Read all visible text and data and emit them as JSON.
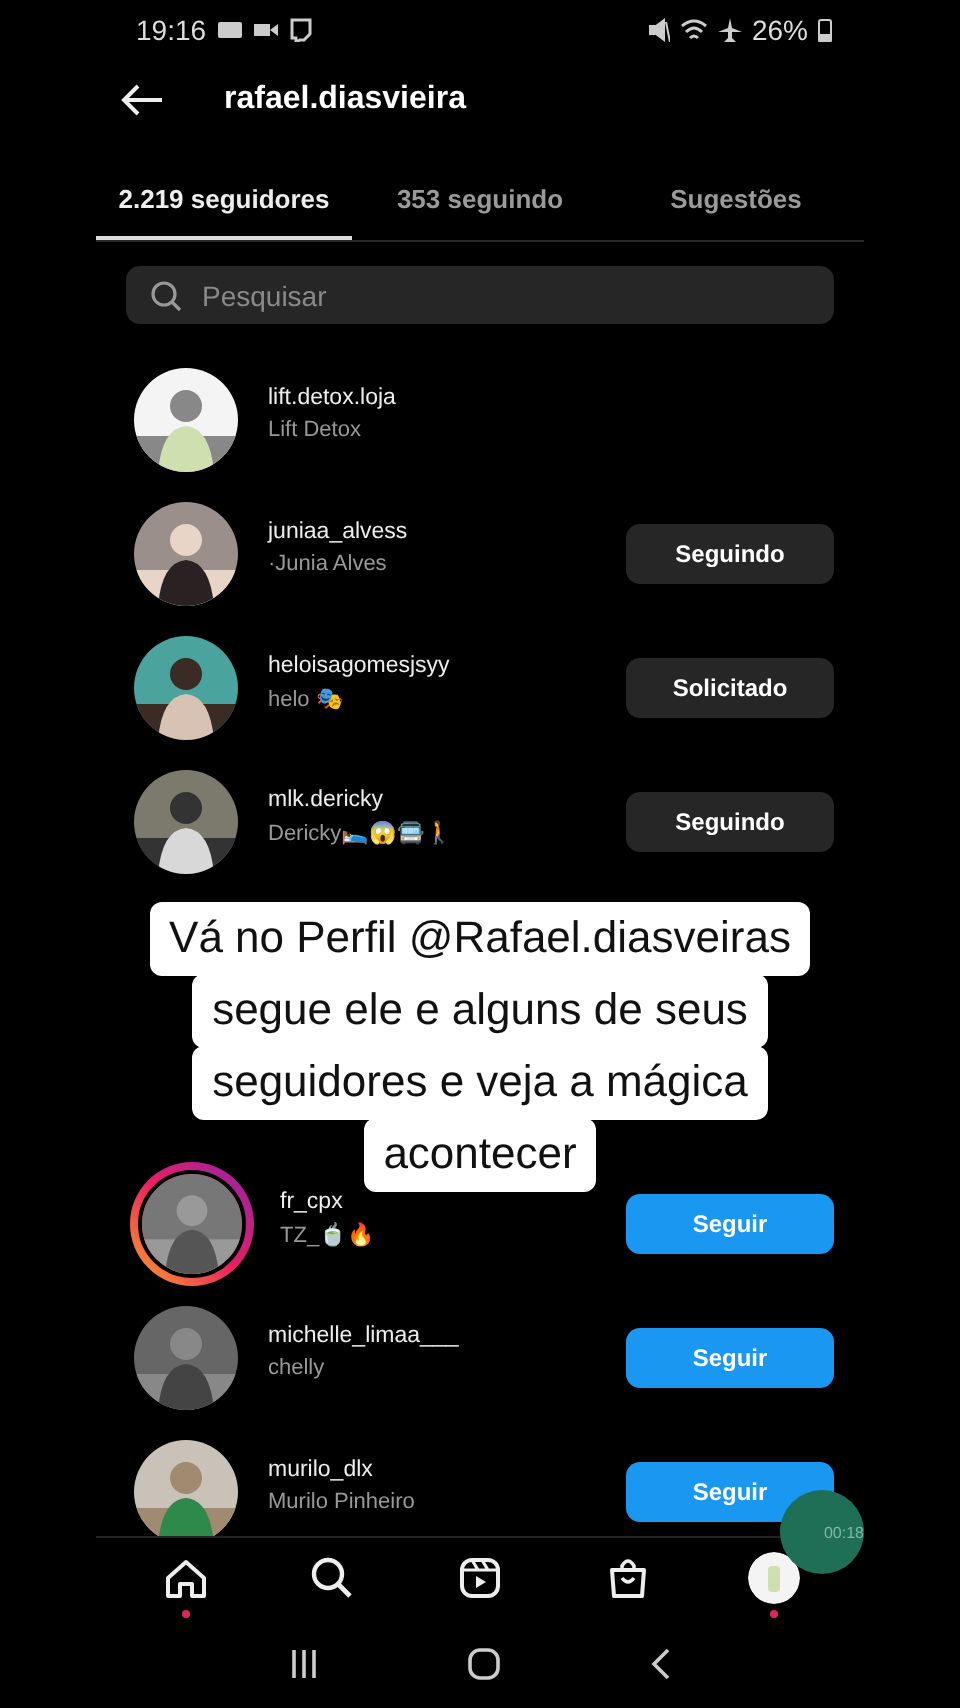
{
  "status_bar": {
    "time": "19:16",
    "battery": "26%"
  },
  "header": {
    "title": "rafael.diasvieira"
  },
  "tabs": [
    {
      "label": "2.219 seguidores",
      "selected": true
    },
    {
      "label": "353 seguindo",
      "selected": false
    },
    {
      "label": "Sugestões",
      "selected": false
    }
  ],
  "search": {
    "placeholder": "Pesquisar"
  },
  "rows": [
    {
      "kind": "account",
      "username": "lift.detox.loja",
      "subtitle": "Lift Detox",
      "story_ring": false
    },
    {
      "kind": "account",
      "username": "juniaa_alvess",
      "subtitle": "·Junia Alves",
      "story_ring": false,
      "button": {
        "kind": "following",
        "label": "Seguindo"
      }
    },
    {
      "kind": "account",
      "username": "heloisagomesjsyy",
      "subtitle": "helo 🎭",
      "story_ring": false,
      "button": {
        "kind": "following",
        "label": "Solicitado"
      }
    },
    {
      "kind": "account",
      "username": "mlk.dericky",
      "subtitle": "Dericky🛌😱🚍🚶",
      "story_ring": false,
      "button": {
        "kind": "following",
        "label": "Seguindo"
      }
    },
    {
      "kind": "account",
      "username": "fr_cpx",
      "subtitle": "TZ_🍵🔥",
      "story_ring": true,
      "button": {
        "kind": "follow",
        "label": "Seguir"
      }
    },
    {
      "kind": "account",
      "username": "michelle_limaa___",
      "subtitle": "chelly",
      "story_ring": false,
      "button": {
        "kind": "follow",
        "label": "Seguir"
      }
    },
    {
      "kind": "account",
      "username": "murilo_dlx",
      "subtitle": "Murilo Pinheiro",
      "story_ring": false,
      "button": {
        "kind": "follow",
        "label": "Seguir"
      }
    }
  ],
  "caption": [
    "Vá no Perfil @Rafael.diasveiras",
    "segue ele e alguns de seus",
    "seguidores e veja a mágica",
    "acontecer"
  ],
  "recorder_timer": "00:18",
  "bottom_nav": [
    {
      "kind": "home",
      "dot": true
    },
    {
      "kind": "search",
      "dot": false
    },
    {
      "kind": "reels",
      "dot": false
    },
    {
      "kind": "shop",
      "dot": false
    },
    {
      "kind": "profile",
      "dot": true
    }
  ]
}
